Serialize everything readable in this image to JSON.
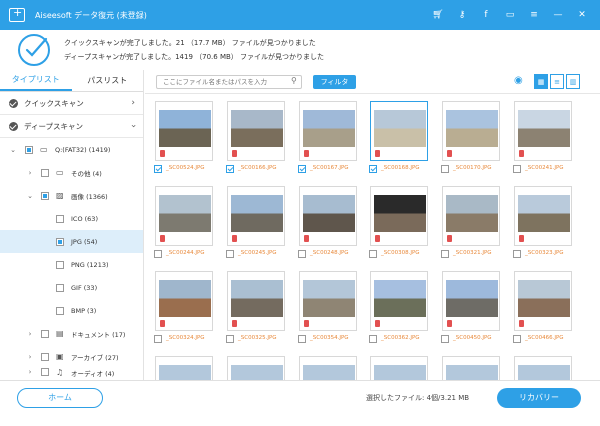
{
  "app": {
    "title": "Aiseesoft データ復元 (未登録)",
    "brand_color": "#2ea0e6",
    "title_icons": [
      "cart-icon",
      "key-icon",
      "facebook-icon",
      "message-icon",
      "menu-icon",
      "minimize-icon",
      "close-icon"
    ]
  },
  "status": {
    "line1": "クイックスキャンが完了しました。21 （17.7 MB） ファイルが見つかりました",
    "line2": "ディープスキャンが完了しました。1419 （70.6 MB） ファイルが見つかりました"
  },
  "tabs": {
    "type_list": "タイプリスト",
    "path_list": "パスリスト"
  },
  "tree": {
    "quick_scan": "クイックスキャン",
    "deep_scan": "ディープスキャン",
    "drive": "Q:(FAT32) (1419)",
    "other": "その他 (4)",
    "image": "画像 (1366)",
    "ico": "ICO (63)",
    "jpg": "JPG (54)",
    "png": "PNG (1213)",
    "gif": "GIF (33)",
    "bmp": "BMP (3)",
    "document": "ドキュメント (17)",
    "archive": "アーカイブ (27)",
    "audio": "オーディオ (4)"
  },
  "toolbar": {
    "search_placeholder": "ここにファイル名またはパスを入力",
    "filter_label": "フィルタ"
  },
  "files": [
    {
      "name": "_SC00524.JPG",
      "checked": true,
      "selected": false
    },
    {
      "name": "_SC00166.JPG",
      "checked": true,
      "selected": false
    },
    {
      "name": "_SC00167.JPG",
      "checked": true,
      "selected": false
    },
    {
      "name": "_SC00168.JPG",
      "checked": true,
      "selected": true
    },
    {
      "name": "_SC00170.JPG",
      "checked": false,
      "selected": false
    },
    {
      "name": "_SC00241.JPG",
      "checked": false,
      "selected": false
    },
    {
      "name": "_SC00244.JPG",
      "checked": false,
      "selected": false
    },
    {
      "name": "_SC00245.JPG",
      "checked": false,
      "selected": false
    },
    {
      "name": "_SC00248.JPG",
      "checked": false,
      "selected": false
    },
    {
      "name": "_SC00308.JPG",
      "checked": false,
      "selected": false
    },
    {
      "name": "_SC00321.JPG",
      "checked": false,
      "selected": false
    },
    {
      "name": "_SC00323.JPG",
      "checked": false,
      "selected": false
    },
    {
      "name": "_SC00324.JPG",
      "checked": false,
      "selected": false
    },
    {
      "name": "_SC00325.JPG",
      "checked": false,
      "selected": false
    },
    {
      "name": "_SC00354.JPG",
      "checked": false,
      "selected": false
    },
    {
      "name": "_SC00362.JPG",
      "checked": false,
      "selected": false
    },
    {
      "name": "_SC00450.JPG",
      "checked": false,
      "selected": false
    },
    {
      "name": "_SC00466.JPG",
      "checked": false,
      "selected": false
    }
  ],
  "footer": {
    "home_label": "ホーム",
    "selected_info": "選択したファイル: 4個/3.21 MB",
    "recover_label": "リカバリー"
  }
}
